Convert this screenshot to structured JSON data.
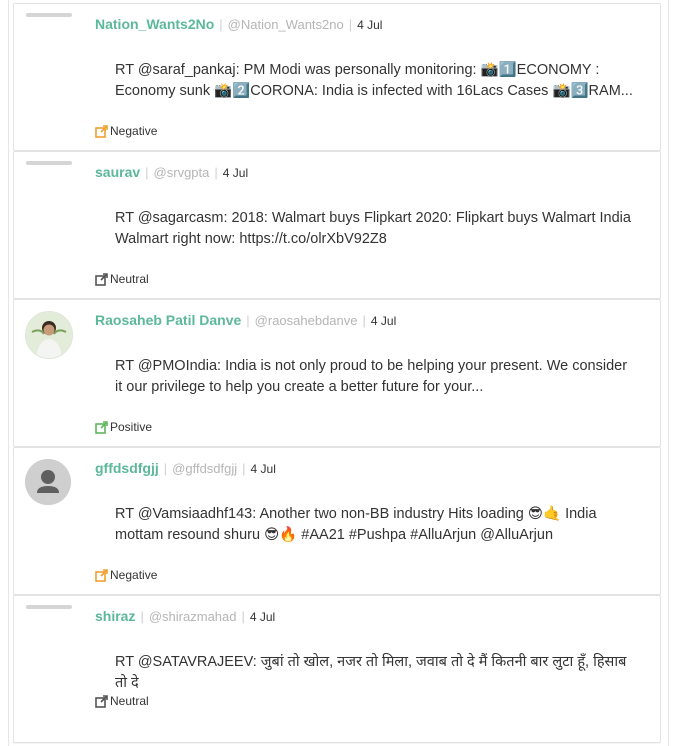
{
  "tweets": [
    {
      "name": "Nation_Wants2No",
      "handle": "@Nation_Wants2no",
      "date": "4 Jul",
      "text": "RT @saraf_pankaj: PM Modi was personally monitoring: 📸1️⃣ECONOMY : Economy sunk 📸2️⃣CORONA: India is infected with 16Lacs Cases 📸3️⃣RAM...",
      "sentiment": "Negative",
      "sentiment_color": "#f0a030",
      "avatar": "placeholder-line"
    },
    {
      "name": "saurav",
      "handle": "@srvgpta",
      "date": "4 Jul",
      "text": "RT @sagarcasm: 2018: Walmart buys Flipkart 2020: Flipkart buys Walmart India Walmart right now: https://t.co/olrXbV92Z8",
      "sentiment": "Neutral",
      "sentiment_color": "#555555",
      "avatar": "placeholder-line"
    },
    {
      "name": "Raosaheb Patil Danve",
      "handle": "@raosahebdanve",
      "date": "4 Jul",
      "text": "RT @PMOIndia: India is not only proud to be helping your present. We consider it our privilege to help you create a better future for your...",
      "sentiment": "Positive",
      "sentiment_color": "#5cb85c",
      "avatar": "photo"
    },
    {
      "name": "gffdsdfgjj",
      "handle": "@gffdsdfgjj",
      "date": "4 Jul",
      "text": "RT @Vamsiaadhf143: Another two non-BB industry Hits loading 😎🤙 India mottam resound shuru 😎🔥 #AA21 #Pushpa #AlluArjun @AlluArjun",
      "sentiment": "Negative",
      "sentiment_color": "#f0a030",
      "avatar": "default"
    },
    {
      "name": "shiraz",
      "handle": "@shirazmahad",
      "date": "4 Jul",
      "text": "RT @SATAVRAJEEV: जुबां तो खोल, नजर तो मिला, जवाब तो दे मैं कितनी बार लुटा हूँ, हिसाब तो दे",
      "sentiment": "Neutral",
      "sentiment_color": "#555555",
      "avatar": "placeholder-line"
    }
  ]
}
